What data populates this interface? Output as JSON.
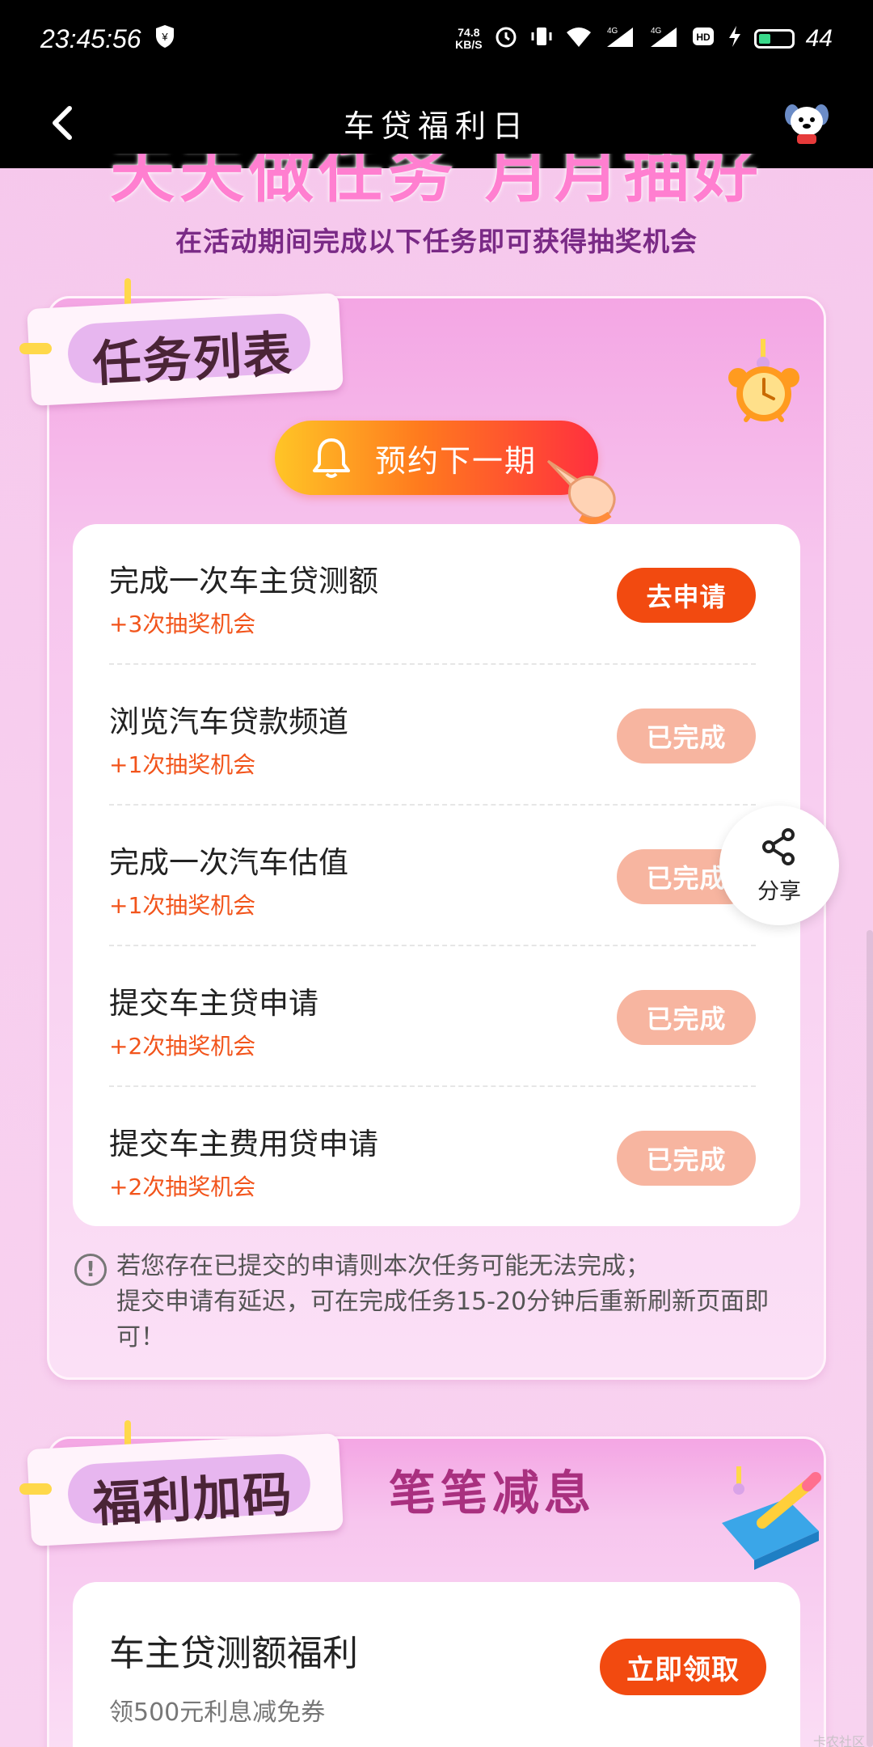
{
  "status_bar": {
    "time": "23:45:56",
    "network_speed_value": "74.8",
    "network_speed_unit": "KB/S",
    "battery_level": "44",
    "icons": [
      "shield-yen-icon",
      "alarm-icon",
      "vibrate-icon",
      "wifi-icon",
      "signal-4g-icon",
      "signal-4g-icon",
      "hd-icon",
      "charging-icon",
      "battery-icon"
    ]
  },
  "nav": {
    "title": "车贷福利日",
    "back_icon": "chevron-left-icon",
    "mascot_icon": "dog-mascot-icon"
  },
  "banner": {
    "title": "天天做任务 月月抽好礼",
    "subtitle": "在活动期间完成以下任务即可获得抽奖机会"
  },
  "task_section": {
    "tag_label": "任务列表",
    "reserve_button_label": "预约下一期",
    "tasks": [
      {
        "title": "完成一次车主贷测额",
        "reward": "+3次抽奖机会",
        "button": "去申请",
        "state": "todo"
      },
      {
        "title": "浏览汽车贷款频道",
        "reward": "+1次抽奖机会",
        "button": "已完成",
        "state": "done"
      },
      {
        "title": "完成一次汽车估值",
        "reward": "+1次抽奖机会",
        "button": "已完成",
        "state": "done"
      },
      {
        "title": "提交车主贷申请",
        "reward": "+2次抽奖机会",
        "button": "已完成",
        "state": "done"
      },
      {
        "title": "提交车主费用贷申请",
        "reward": "+2次抽奖机会",
        "button": "已完成",
        "state": "done"
      }
    ],
    "notice_line_1": "若您存在已提交的申请则本次任务可能无法完成；",
    "notice_line_2": "提交申请有延迟，可在完成任务15-20分钟后重新刷新页面即可！"
  },
  "share": {
    "label": "分享"
  },
  "bonus_section": {
    "tag_label": "福利加码",
    "heading": "笔笔减息",
    "item_title": "车主贷测额福利",
    "item_subtitle": "领500元利息减免券",
    "button_label": "立即领取"
  },
  "watermark": "卡农社区",
  "colors": {
    "accent_orange": "#f24a10",
    "done_button": "#f7b5a0",
    "reward_text": "#f2541b",
    "background_pink": "#f7cdee"
  }
}
